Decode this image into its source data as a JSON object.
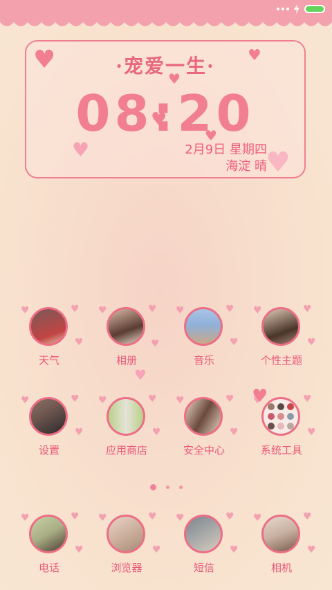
{
  "status_bar": {
    "battery_color": "#62d35b"
  },
  "widget": {
    "title": "·宠爱一生·",
    "time": "08:20",
    "date": "2月9日 星期四",
    "location_weather": "海淀 晴"
  },
  "apps_row1": [
    {
      "label": "天气",
      "colors": [
        "#7a5a58",
        "#c24444"
      ]
    },
    {
      "label": "相册",
      "colors": [
        "#d9b9a4",
        "#5a3c33"
      ]
    },
    {
      "label": "音乐",
      "colors": [
        "#a9c4e6",
        "#c9a889"
      ]
    },
    {
      "label": "个性主题",
      "colors": [
        "#e0c9b4",
        "#4a352a"
      ]
    }
  ],
  "apps_row2": [
    {
      "label": "设置",
      "colors": [
        "#6f5750",
        "#2c2a2a"
      ]
    },
    {
      "label": "应用商店",
      "colors": [
        "#b9d18a",
        "#e5e2d7"
      ]
    },
    {
      "label": "安全中心",
      "colors": [
        "#6a4a3c",
        "#e7d2c0"
      ]
    },
    {
      "label": "系统工具",
      "colors": [
        "#f6ebe6",
        "#c85b6b"
      ]
    }
  ],
  "apps_row3": [
    {
      "label": "电话",
      "colors": [
        "#cbd2a6",
        "#4b3d32"
      ]
    },
    {
      "label": "浏览器",
      "colors": [
        "#e9d2c4",
        "#a58b77"
      ]
    },
    {
      "label": "短信",
      "colors": [
        "#7c8791",
        "#d8ccbf"
      ]
    },
    {
      "label": "相机",
      "colors": [
        "#e8d9cf",
        "#7b5d4b"
      ]
    }
  ],
  "pager": {
    "pages": 3,
    "active_index": 0
  }
}
